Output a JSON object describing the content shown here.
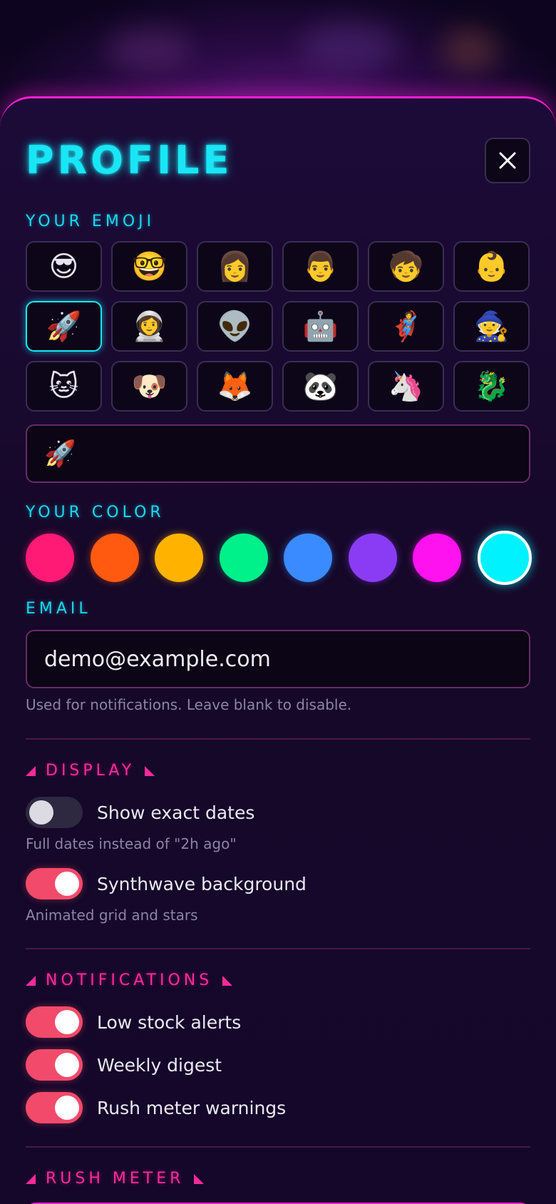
{
  "header": {
    "title": "PROFILE",
    "close_icon": "close-icon"
  },
  "emoji_section": {
    "label": "YOUR EMOJI",
    "options": [
      "😎",
      "🤓",
      "👩",
      "👨",
      "🧒",
      "👶",
      "🚀",
      "👩‍🚀",
      "👽",
      "🤖",
      "🦸",
      "🧙",
      "🐱",
      "🐶",
      "🦊",
      "🐼",
      "🦄",
      "🐉"
    ],
    "selected": "🚀",
    "input_value": "🚀"
  },
  "color_section": {
    "label": "YOUR COLOR",
    "swatches": [
      "#ff1a75",
      "#ff5a0f",
      "#ffb300",
      "#00f08a",
      "#3a8bff",
      "#8a3cf5",
      "#ff12f0",
      "#00f2ff"
    ],
    "selected": "#00f2ff"
  },
  "email_section": {
    "label": "EMAIL",
    "value": "demo@example.com",
    "hint": "Used for notifications. Leave blank to disable."
  },
  "display_section": {
    "label": "DISPLAY",
    "toggles": [
      {
        "label": "Show exact dates",
        "on": false,
        "hint": "Full dates instead of \"2h ago\""
      },
      {
        "label": "Synthwave background",
        "on": true,
        "hint": "Animated grid and stars"
      }
    ]
  },
  "notifications_section": {
    "label": "NOTIFICATIONS",
    "toggles": [
      {
        "label": "Low stock alerts",
        "on": true
      },
      {
        "label": "Weekly digest",
        "on": true
      },
      {
        "label": "Rush meter warnings",
        "on": true
      }
    ]
  },
  "rush_section": {
    "label": "RUSH METER"
  }
}
